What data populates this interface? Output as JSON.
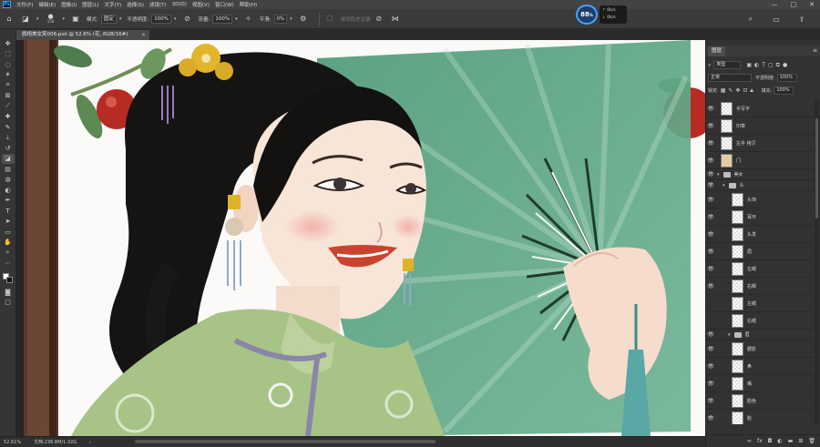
{
  "menubar": {
    "logo": "Ps",
    "items": [
      "文件(F)",
      "编辑(E)",
      "图像(I)",
      "图层(L)",
      "文字(Y)",
      "选择(S)",
      "滤镜(T)",
      "3D(D)",
      "视图(V)",
      "窗口(W)",
      "帮助(H)"
    ],
    "window_controls": [
      "—",
      "□",
      "✕"
    ]
  },
  "options_bar": {
    "brush_size": "150",
    "mode_label": "模式:",
    "mode_value": "固定",
    "opacity_label": "不透明度:",
    "opacity_value": "100%",
    "flow_label": "流量:",
    "flow_value": "100%",
    "smoothing_label": "平滑:",
    "smoothing_value": "0%",
    "history_label": "抹到历史记录"
  },
  "performance": {
    "percent": "88",
    "unit": "%",
    "up": "0k/s",
    "down": "0k/s"
  },
  "document_tab": {
    "title": "旗袍美女笑008.psd @ 52.6% (花, RGB/16#)",
    "close": "×"
  },
  "status_bar": {
    "zoom": "52.61%",
    "doc_info": "文档:236.8M/1.32G"
  },
  "layers_panel": {
    "tab_label": "图层",
    "kind_filter": "类型",
    "blend_mode": "正常",
    "opacity_label": "不透明度:",
    "opacity_value": "100%",
    "lock_label": "锁定:",
    "fill_label": "填充:",
    "fill_value": "100%",
    "layers": [
      {
        "name": "手写字",
        "type": "layer",
        "visible": true,
        "indent": 0
      },
      {
        "name": "印章",
        "type": "layer",
        "visible": true,
        "indent": 0
      },
      {
        "name": "左手 拷贝",
        "type": "layer",
        "visible": true,
        "indent": 0
      },
      {
        "name": "门",
        "type": "layer-photo",
        "visible": true,
        "indent": 0
      },
      {
        "name": "美女",
        "type": "group",
        "visible": true,
        "indent": 0
      },
      {
        "name": "头",
        "type": "group",
        "visible": true,
        "indent": 1
      },
      {
        "name": "头饰",
        "type": "layer",
        "visible": true,
        "indent": 2
      },
      {
        "name": "耳环",
        "type": "layer",
        "visible": true,
        "indent": 2
      },
      {
        "name": "头发",
        "type": "layer",
        "visible": true,
        "indent": 2
      },
      {
        "name": "眉",
        "type": "layer",
        "visible": true,
        "indent": 2
      },
      {
        "name": "左眼",
        "type": "layer",
        "visible": true,
        "indent": 2
      },
      {
        "name": "右眼",
        "type": "layer",
        "visible": true,
        "indent": 2
      },
      {
        "name": "左眼",
        "type": "layer",
        "visible": false,
        "indent": 2
      },
      {
        "name": "右眼",
        "type": "layer",
        "visible": false,
        "indent": 2
      },
      {
        "name": "眉",
        "type": "group",
        "visible": true,
        "indent": 2
      },
      {
        "name": "腮影",
        "type": "layer",
        "visible": true,
        "indent": 2
      },
      {
        "name": "鼻",
        "type": "layer",
        "visible": true,
        "indent": 2
      },
      {
        "name": "嘴",
        "type": "layer",
        "visible": true,
        "indent": 2
      },
      {
        "name": "脸色",
        "type": "layer",
        "visible": true,
        "indent": 2
      },
      {
        "name": "脸",
        "type": "layer",
        "visible": true,
        "indent": 2
      }
    ]
  },
  "colors": {
    "ps_blue": "#31a8ff",
    "panel_bg": "#323232",
    "fan_green": "#5e9e7a",
    "dress_green": "#a7c486",
    "lip_red": "#c8442f"
  }
}
